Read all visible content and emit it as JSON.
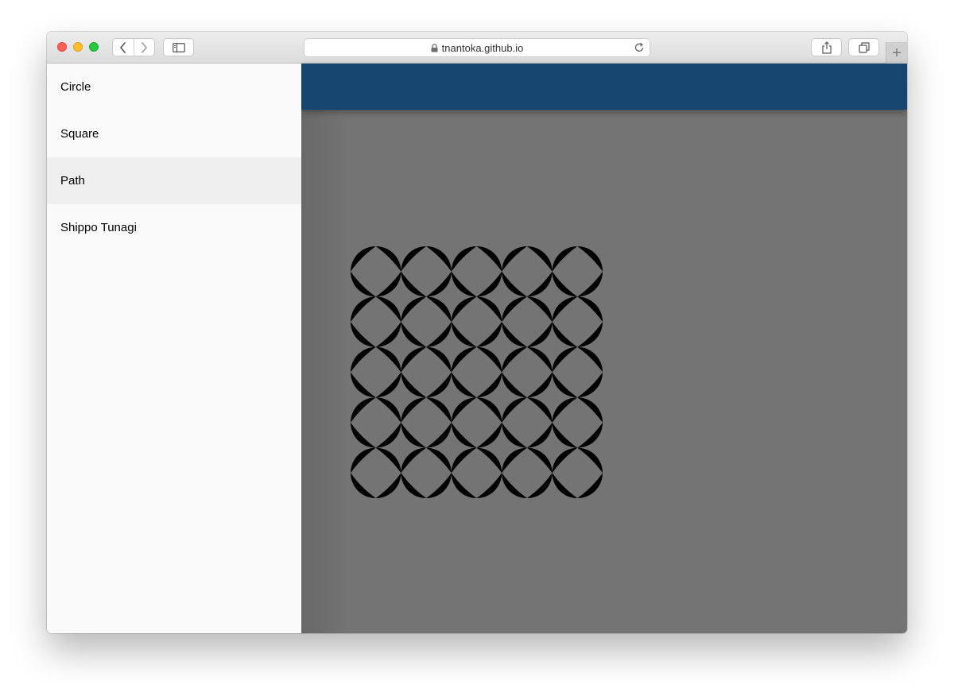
{
  "browser": {
    "url": "tnantoka.github.io",
    "icons": {
      "back": "chevron-left-icon",
      "forward": "chevron-right-icon",
      "sidebar": "sidebar-icon",
      "lock": "lock-icon",
      "reload": "reload-icon",
      "share": "share-icon",
      "tabs": "tabs-icon",
      "new_tab": "plus-icon"
    },
    "new_tab_label": "+"
  },
  "drawer": {
    "items": [
      {
        "label": "Circle",
        "active": false
      },
      {
        "label": "Square",
        "active": false
      },
      {
        "label": "Path",
        "active": true
      },
      {
        "label": "Shippo Tunagi",
        "active": false
      }
    ]
  },
  "colors": {
    "appbar": "#16466f",
    "canvas_background": "#747474",
    "drawer_background": "#fafafa",
    "active_item": "#efefef",
    "pattern_fill": "#000000"
  },
  "pattern": {
    "name": "shippo-tunagi",
    "rows": 5,
    "columns": 5
  }
}
